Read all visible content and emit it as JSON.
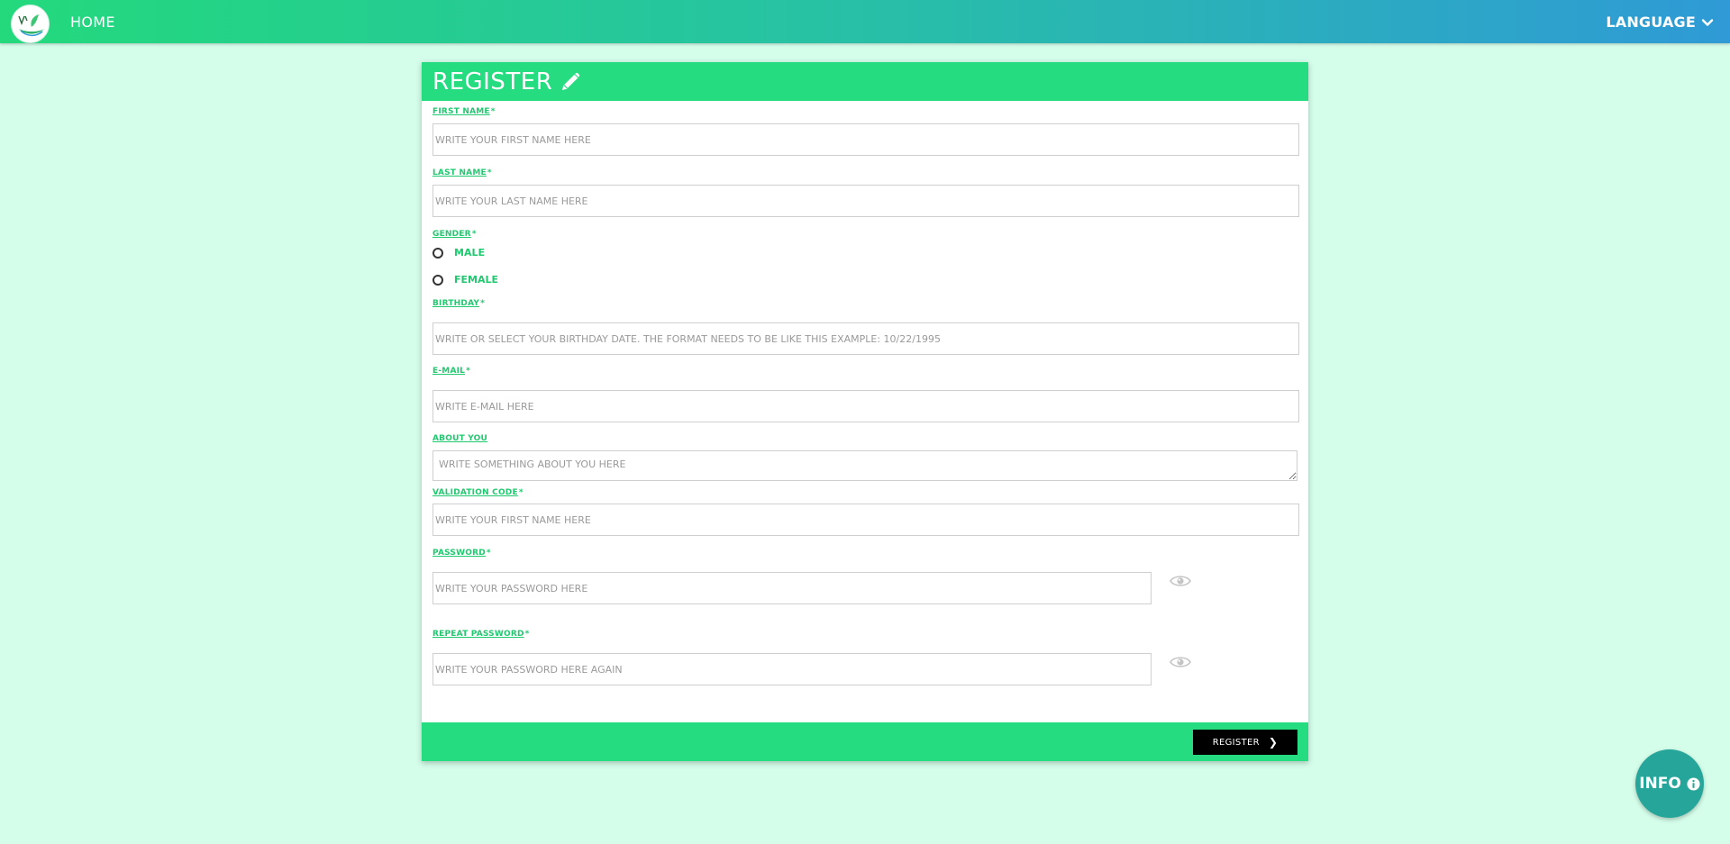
{
  "nav": {
    "home_label": "HOME",
    "language_label": "LANGUAGE"
  },
  "form": {
    "title": "REGISTER",
    "first_name": {
      "label": "FIRST NAME",
      "required": "*",
      "placeholder": "WRITE YOUR FIRST NAME HERE"
    },
    "last_name": {
      "label": "LAST NAME",
      "required": "*",
      "placeholder": "WRITE YOUR LAST NAME HERE"
    },
    "gender": {
      "label": "GENDER",
      "required": "*",
      "options": [
        {
          "label": "MALE"
        },
        {
          "label": "FEMALE"
        }
      ]
    },
    "birthday": {
      "label": "BIRTHDAY",
      "required": "*",
      "placeholder": "WRITE OR SELECT YOUR BIRTHDAY DATE. THE FORMAT NEEDS TO BE LIKE THIS EXAMPLE: 10/22/1995"
    },
    "email": {
      "label": "E-MAIL",
      "required": "*",
      "placeholder": "WRITE E-MAIL HERE"
    },
    "about": {
      "label": "ABOUT YOU",
      "placeholder": "WRITE SOMETHING ABOUT YOU HERE"
    },
    "validation_code": {
      "label": "VALIDATION CODE",
      "required": "*",
      "placeholder": "WRITE YOUR FIRST NAME HERE"
    },
    "password": {
      "label": "PASSWORD",
      "required": "*",
      "placeholder": "WRITE YOUR PASSWORD HERE"
    },
    "repeat_password": {
      "label": "REPEAT PASSWORD",
      "required": "*",
      "placeholder": "WRITE YOUR PASSWORD HERE AGAIN"
    },
    "submit_label": "REGISTER",
    "submit_chevron": "❯"
  },
  "info_fab": {
    "label": "INFO"
  },
  "colors": {
    "background": "#d4fdea",
    "accent_green": "#26dc80",
    "label_green": "#20c96f",
    "fab_teal": "#26a69a",
    "nav_gradient_start": "#23d97c",
    "nav_gradient_end": "#2f9ad6"
  },
  "icons": {
    "logo": "site-logo",
    "title": "pencil-icon",
    "language": "chevron-down-icon",
    "password_toggle": "eye-icon",
    "info": "info-circle-icon"
  }
}
